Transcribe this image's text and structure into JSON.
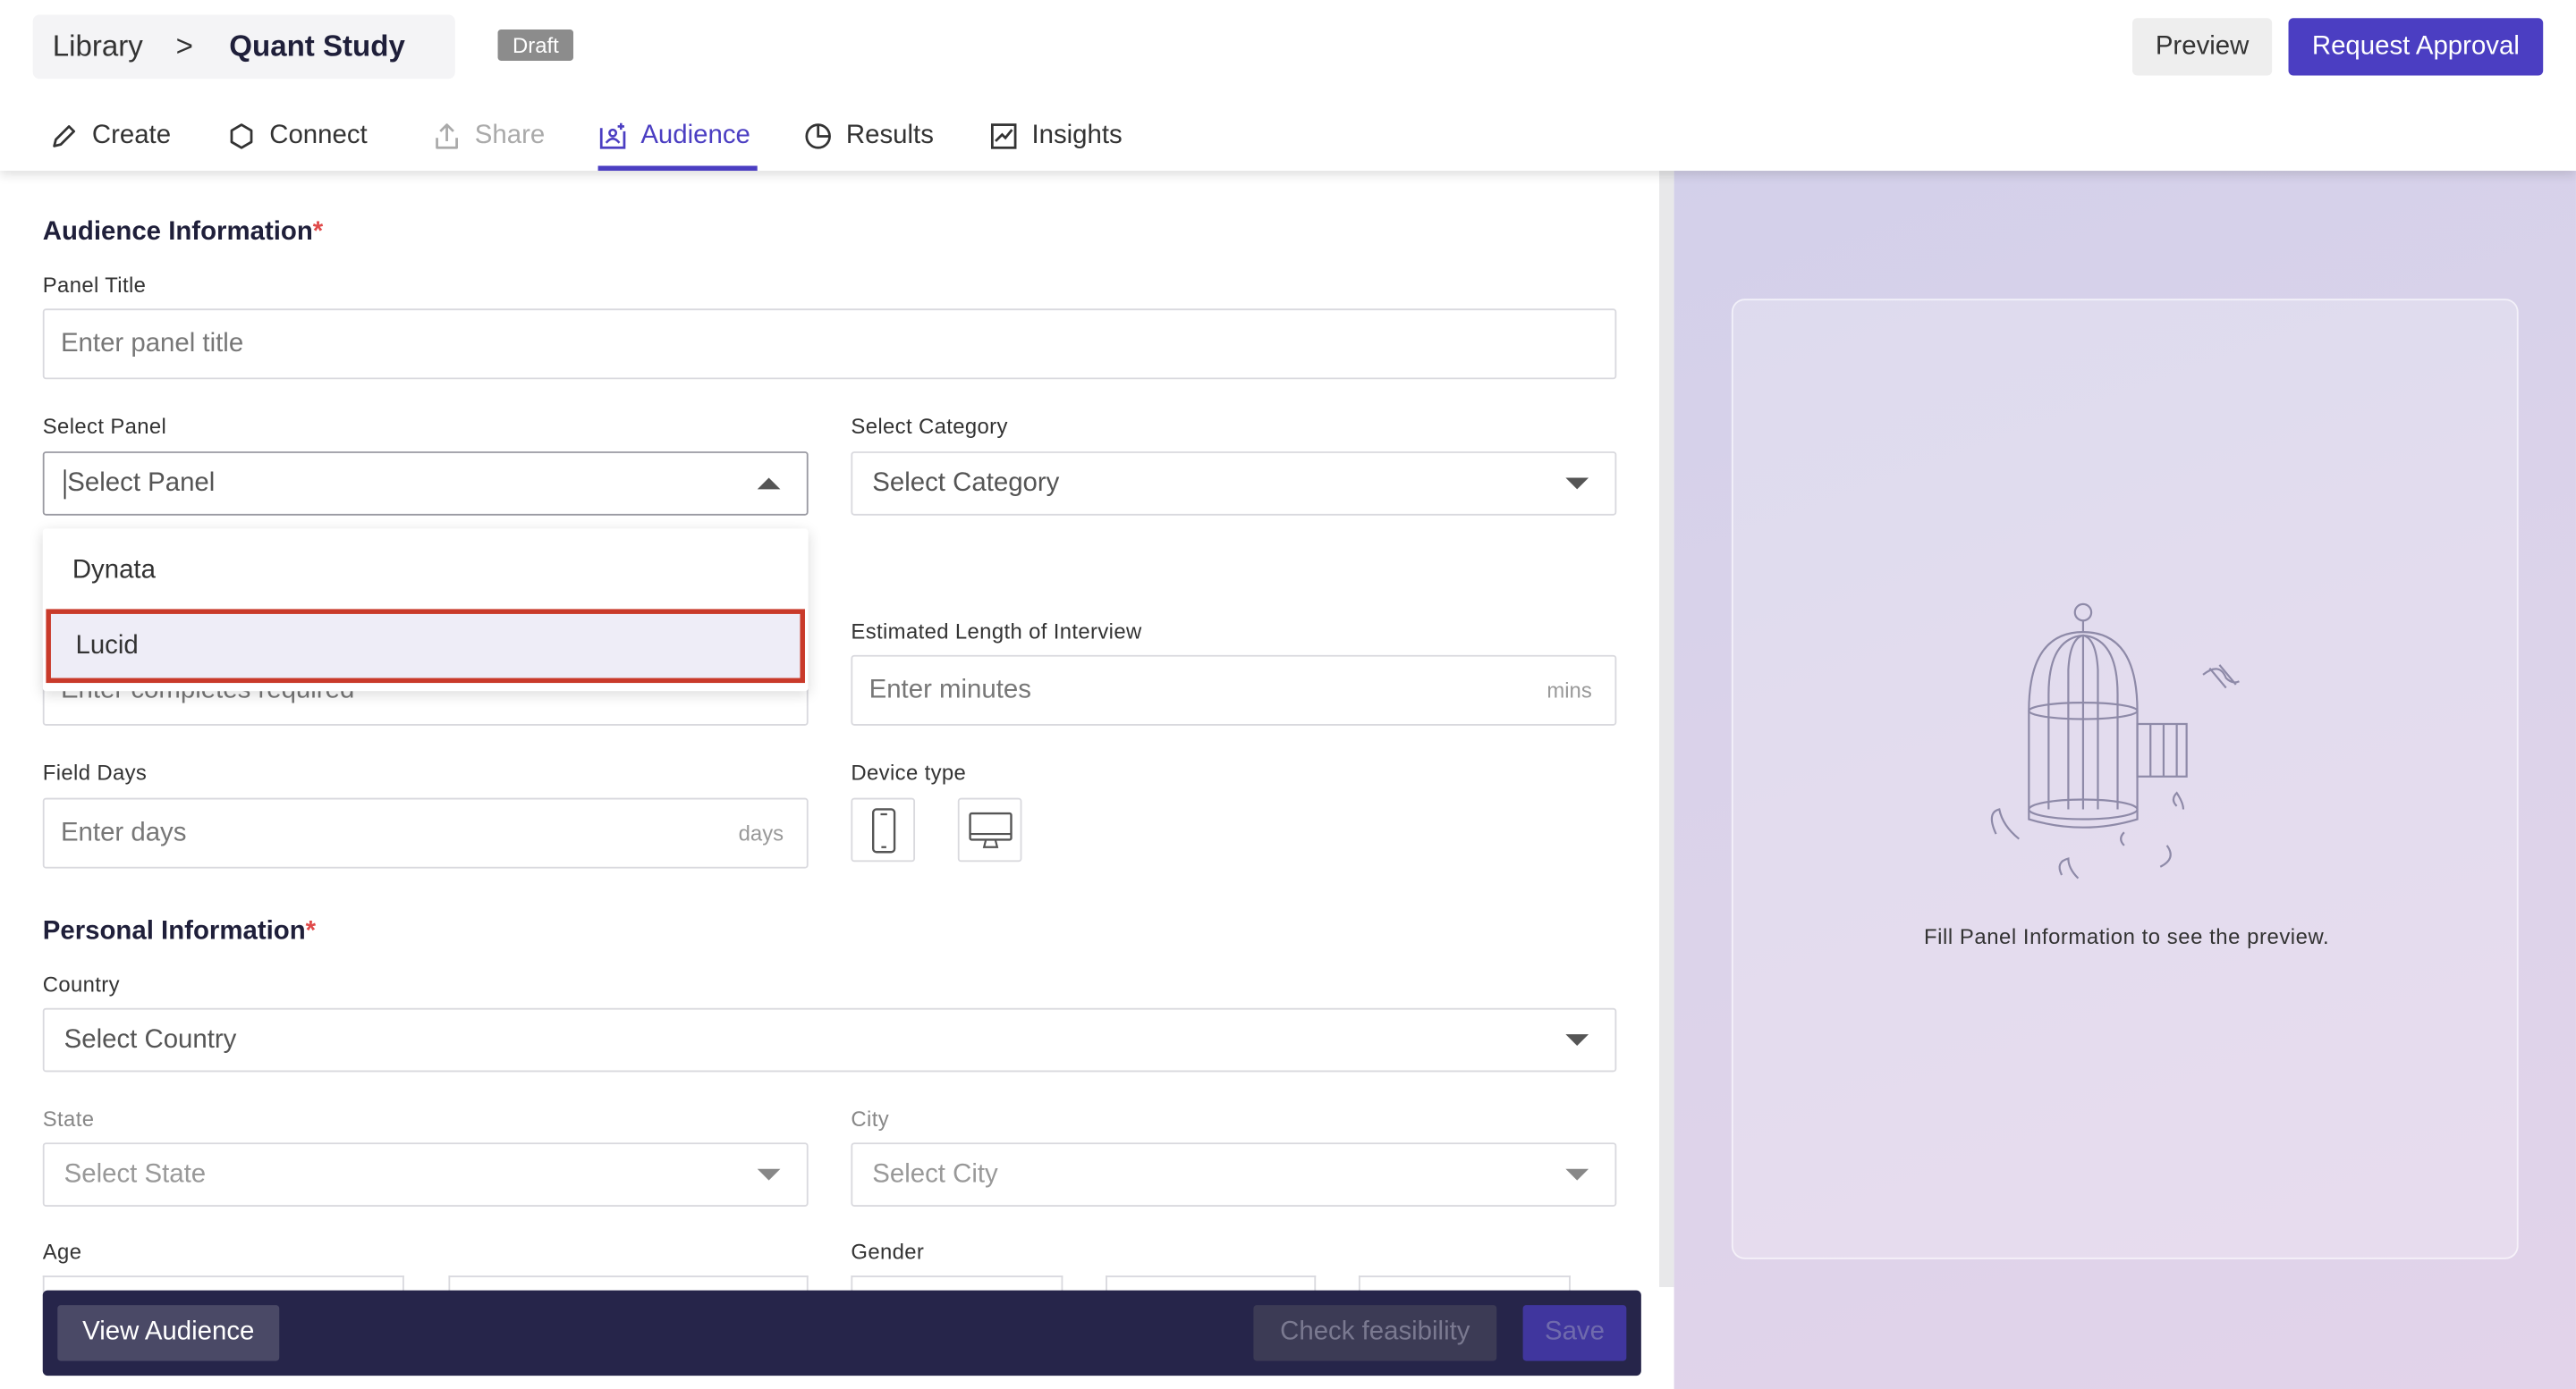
{
  "breadcrumb": {
    "library": "Library",
    "separator": ">",
    "current": "Quant Study",
    "status_badge": "Draft"
  },
  "header_actions": {
    "preview": "Preview",
    "request_approval": "Request Approval"
  },
  "tabs": [
    {
      "label": "Create",
      "icon": "pencil-icon",
      "state": "normal"
    },
    {
      "label": "Connect",
      "icon": "hexagon-icon",
      "state": "normal"
    },
    {
      "label": "Share",
      "icon": "share-upload-icon",
      "state": "disabled"
    },
    {
      "label": "Audience",
      "icon": "audience-icon",
      "state": "active"
    },
    {
      "label": "Results",
      "icon": "pie-chart-icon",
      "state": "normal"
    },
    {
      "label": "Insights",
      "icon": "line-chart-icon",
      "state": "normal"
    }
  ],
  "audience_info": {
    "title": "Audience Information",
    "required_mark": "*",
    "panel_title": {
      "label": "Panel Title",
      "placeholder": "Enter panel title"
    },
    "select_panel": {
      "label": "Select Panel",
      "placeholder": "Select Panel",
      "options": [
        "Dynata",
        "Lucid"
      ],
      "highlighted": "Lucid"
    },
    "select_category": {
      "label": "Select Category",
      "placeholder": "Select Category"
    },
    "completes": {
      "placeholder": "Enter completes required"
    },
    "length_of_interview": {
      "label": "Estimated Length of Interview",
      "placeholder": "Enter minutes",
      "suffix": "mins"
    },
    "field_days": {
      "label": "Field Days",
      "placeholder": "Enter days",
      "suffix": "days"
    },
    "device_type": {
      "label": "Device type",
      "options": [
        "mobile-icon",
        "desktop-icon"
      ]
    }
  },
  "personal_info": {
    "title": "Personal Information",
    "required_mark": "*",
    "country": {
      "label": "Country",
      "placeholder": "Select Country"
    },
    "state": {
      "label": "State",
      "placeholder": "Select State"
    },
    "city": {
      "label": "City",
      "placeholder": "Select City"
    },
    "age": {
      "label": "Age"
    },
    "gender": {
      "label": "Gender"
    }
  },
  "footer": {
    "view_audience": "View Audience",
    "check_feasibility": "Check feasibility",
    "save": "Save"
  },
  "preview_panel": {
    "message": "Fill Panel Information to see the preview.",
    "illustration": "birdcage-illustration"
  },
  "colors": {
    "accent": "#4b3ec2",
    "footer_bg": "#26254a",
    "highlight_outline": "#c93a2a",
    "required": "#e04a4a"
  }
}
